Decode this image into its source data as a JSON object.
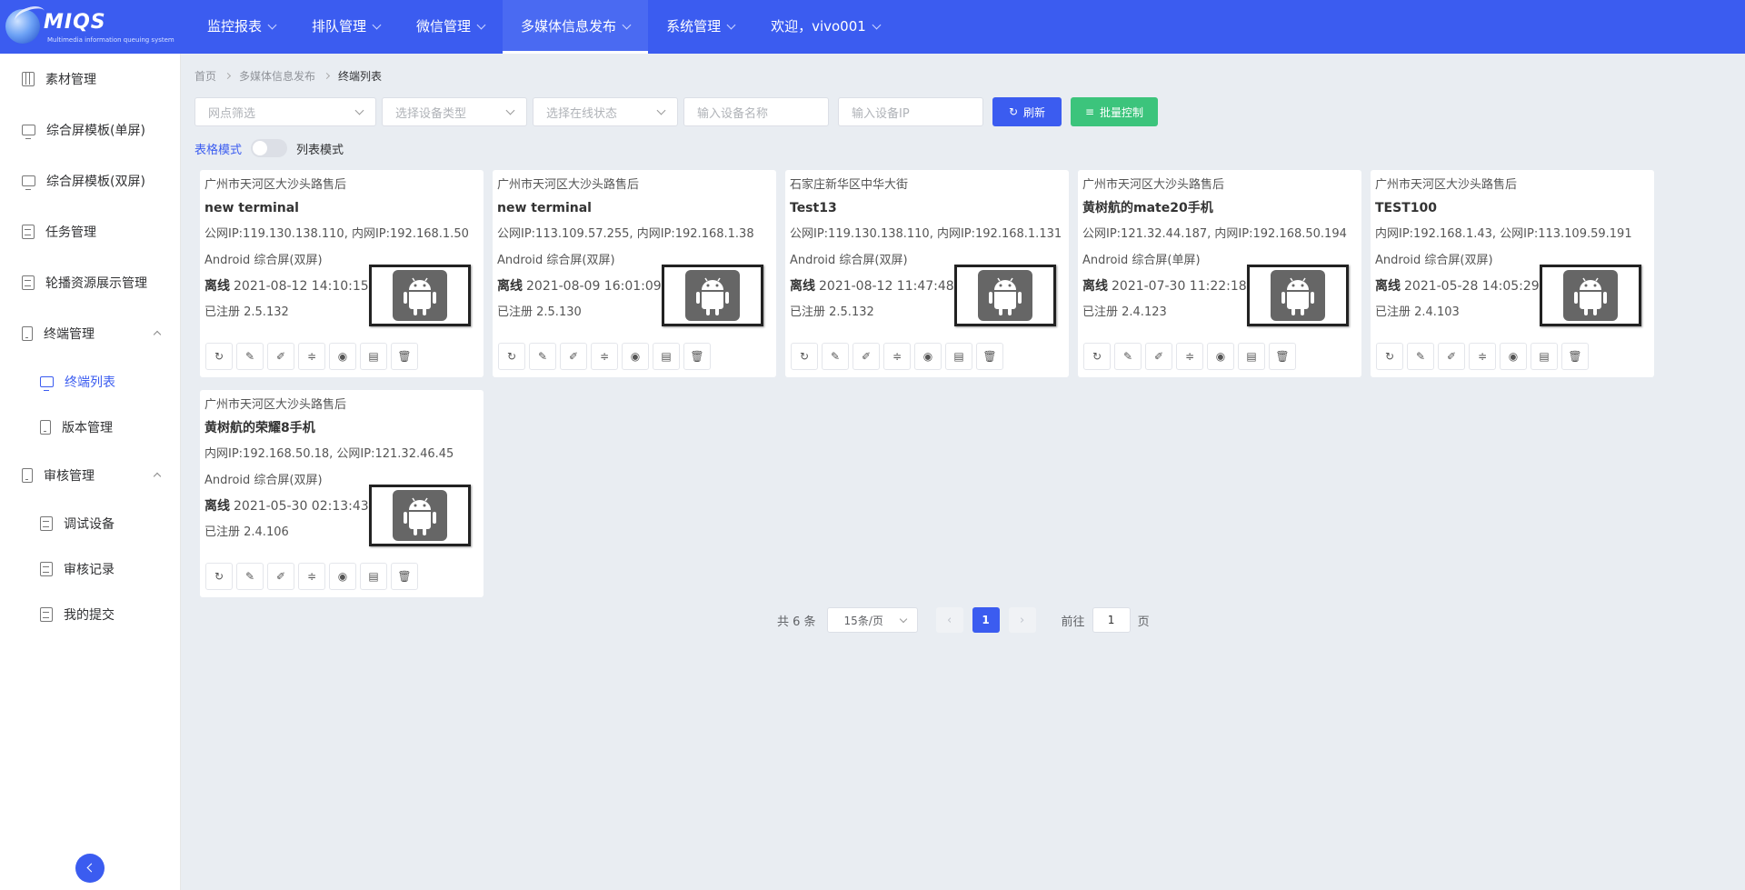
{
  "app": {
    "brand": "MIQS",
    "tagline": "Multimedia information queuing system"
  },
  "topnav": [
    {
      "label": "监控报表"
    },
    {
      "label": "排队管理"
    },
    {
      "label": "微信管理"
    },
    {
      "label": "多媒体信息发布"
    },
    {
      "label": "系统管理"
    },
    {
      "label": "欢迎，vivo001"
    }
  ],
  "sidebar": {
    "items": [
      {
        "label": "素材管理",
        "icon": "grid-icon"
      },
      {
        "label": "综合屏模板(单屏)",
        "icon": "screen-icon"
      },
      {
        "label": "综合屏模板(双屏)",
        "icon": "screen-icon"
      },
      {
        "label": "任务管理",
        "icon": "document-icon"
      },
      {
        "label": "轮播资源展示管理",
        "icon": "save-icon"
      },
      {
        "label": "终端管理",
        "icon": "phone-icon"
      },
      {
        "label": "终端列表",
        "icon": "monitor-icon"
      },
      {
        "label": "版本管理",
        "icon": "phone-icon"
      },
      {
        "label": "审核管理",
        "icon": "phone-icon"
      },
      {
        "label": "调试设备",
        "icon": "document-icon"
      },
      {
        "label": "审核记录",
        "icon": "document-check-icon"
      },
      {
        "label": "我的提交",
        "icon": "document-icon"
      }
    ]
  },
  "breadcrumb": [
    "首页",
    "多媒体信息发布",
    "终端列表"
  ],
  "filters": {
    "site": "网点筛选",
    "device_type": "选择设备类型",
    "online_status": "选择在线状态",
    "device_name": "输入设备名称",
    "device_ip": "输入设备IP",
    "refresh_label": "刷新",
    "batch_label": "批量控制"
  },
  "mode": {
    "grid": "表格模式",
    "list": "列表模式"
  },
  "terminals": [
    {
      "location": "广州市天河区大沙头路售后",
      "name": "new terminal",
      "ip": "公网IP:119.130.138.110, 内网IP:192.168.1.50",
      "type": "Android 综合屏(双屏)",
      "status": "离线",
      "time": "2021-08-12 14:10:15",
      "reg": "已注册 2.5.132"
    },
    {
      "location": "广州市天河区大沙头路售后",
      "name": "new terminal",
      "ip": "公网IP:113.109.57.255, 内网IP:192.168.1.38",
      "type": "Android 综合屏(双屏)",
      "status": "离线",
      "time": "2021-08-09 16:01:09",
      "reg": "已注册 2.5.130"
    },
    {
      "location": "石家庄新华区中华大街",
      "name": "Test13",
      "ip": "公网IP:119.130.138.110, 内网IP:192.168.1.131",
      "type": "Android 综合屏(双屏)",
      "status": "离线",
      "time": "2021-08-12 11:47:48",
      "reg": "已注册 2.5.132"
    },
    {
      "location": "广州市天河区大沙头路售后",
      "name": "黄树航的mate20手机",
      "ip": "公网IP:121.32.44.187, 内网IP:192.168.50.194",
      "type": "Android 综合屏(单屏)",
      "status": "离线",
      "time": "2021-07-30 11:22:18",
      "reg": "已注册 2.4.123"
    },
    {
      "location": "广州市天河区大沙头路售后",
      "name": "TEST100",
      "ip": "内网IP:192.168.1.43, 公网IP:113.109.59.191",
      "type": "Android 综合屏(双屏)",
      "status": "离线",
      "time": "2021-05-28 14:05:29",
      "reg": "已注册 2.4.103"
    },
    {
      "location": "广州市天河区大沙头路售后",
      "name": "黄树航的荣耀8手机",
      "ip": "内网IP:192.168.50.18, 公网IP:121.32.46.45",
      "type": "Android 综合屏(双屏)",
      "status": "离线",
      "time": "2021-05-30 02:13:43",
      "reg": "已注册 2.4.106"
    }
  ],
  "card_actions": [
    {
      "icon": "refresh-icon",
      "glyph": "↻"
    },
    {
      "icon": "edit-icon",
      "glyph": "✎"
    },
    {
      "icon": "edit-alt-icon",
      "glyph": "✐"
    },
    {
      "icon": "settings-sliders-icon",
      "glyph": "≑"
    },
    {
      "icon": "view-icon",
      "glyph": "◉"
    },
    {
      "icon": "log-document-icon",
      "glyph": "▤"
    },
    {
      "icon": "delete-icon",
      "glyph": "🗑"
    }
  ],
  "pagination": {
    "total": "共 6 条",
    "page_size": "15条/页",
    "current_page": "1",
    "goto_label": "前往",
    "goto_value": "1",
    "page_suffix": "页"
  },
  "colors": {
    "primary": "#3b5cf0",
    "success": "#3cc47c",
    "background": "#e9edf2"
  }
}
